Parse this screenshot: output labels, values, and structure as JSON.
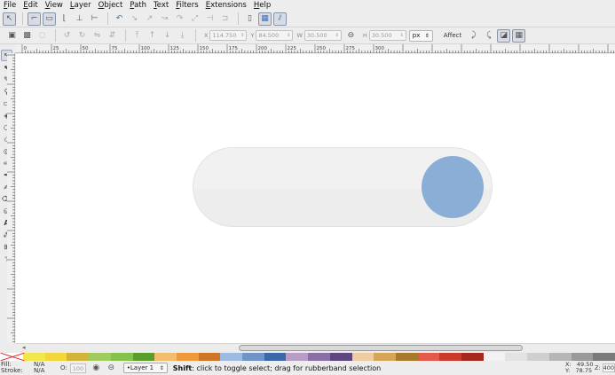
{
  "menu": [
    "File",
    "Edit",
    "View",
    "Layer",
    "Object",
    "Path",
    "Text",
    "Filters",
    "Extensions",
    "Help"
  ],
  "toolbar": {
    "x_label": "X",
    "x_value": "114.750",
    "y_label": "Y",
    "y_value": "84.500",
    "w_label": "W",
    "w_value": "30.500",
    "h_label": "H",
    "h_value": "30.500",
    "unit": "px",
    "affect_label": "Affect"
  },
  "ruler_labels": [
    "0",
    "25",
    "50",
    "75",
    "100",
    "125",
    "150",
    "175",
    "200",
    "225",
    "250",
    "275",
    "300"
  ],
  "status": {
    "fill_label": "Fill:",
    "stroke_label": "Stroke:",
    "fill_value": "N/A",
    "stroke_value": "N/A",
    "opacity_label": "O:",
    "opacity_value": "100",
    "layer": "•Layer 1",
    "message_key": "Shift",
    "message_rest": ": click to toggle select; drag for rubberband selection",
    "x_label": "X:",
    "x_value": "49.50",
    "y_label": "Y:",
    "y_value": "78.75",
    "zoom_label": "Z:",
    "zoom_value": "400"
  },
  "palette": [
    "#f2e74a",
    "#f4d63a",
    "#d2b43a",
    "#9fcb5f",
    "#85c24b",
    "#5b9d2c",
    "#f2be6b",
    "#f0993a",
    "#cf7526",
    "#9dbbe0",
    "#6f94c8",
    "#3b68a8",
    "#b89cc4",
    "#8b6ea3",
    "#5e4680",
    "#f0cda0",
    "#d6a555",
    "#a87a2c",
    "#e25b4a",
    "#cc3a2b",
    "#a52a1d",
    "#f2f2f2",
    "#e2e2e2",
    "#cfcfcf",
    "#b6b6b6",
    "#9a9a9a",
    "#7a7a7a"
  ],
  "colors": {
    "toggle_track": "#ededed",
    "toggle_knob": "#8aaed6"
  }
}
